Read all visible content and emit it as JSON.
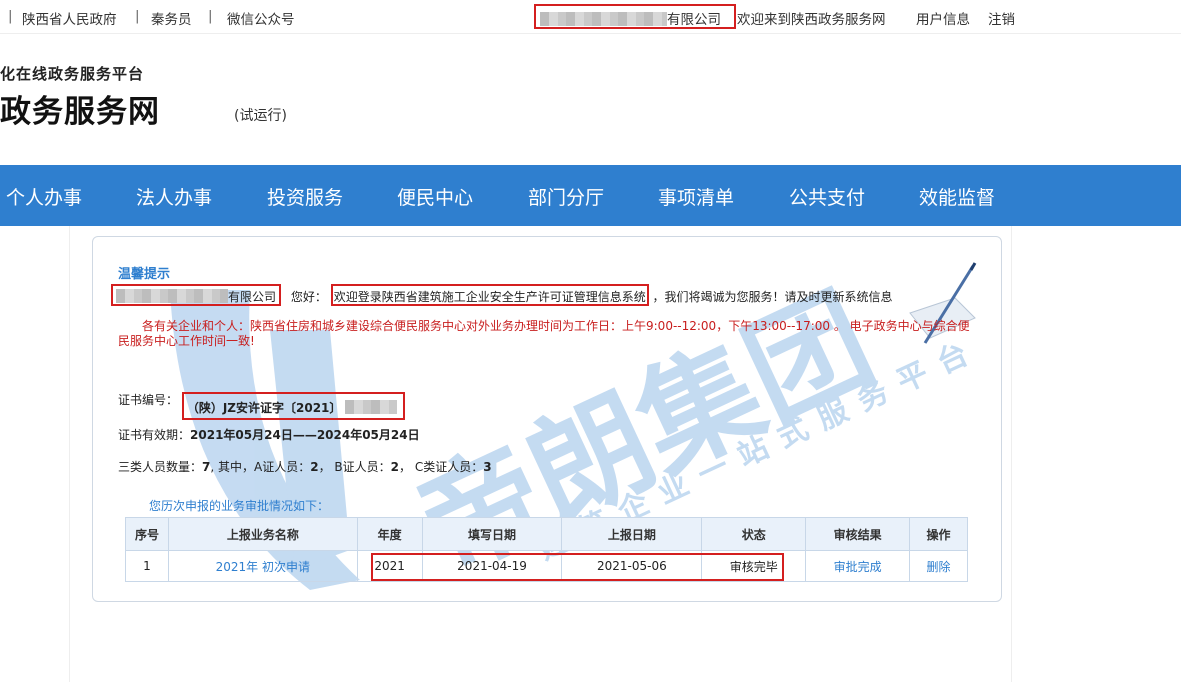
{
  "topbar": {
    "gov_link": "陕西省人民政府",
    "qin_link": "秦务员",
    "wechat_link": "微信公众号",
    "company_suffix": "有限公司",
    "welcome": "欢迎来到陕西政务服务网",
    "user_info": "用户信息",
    "logout": "注销"
  },
  "logo": {
    "subtitle": "化在线政务服务平台",
    "title": "政务服务网",
    "trial": "(试运行)"
  },
  "nav": [
    "个人办事",
    "法人办事",
    "投资服务",
    "便民中心",
    "部门分厅",
    "事项清单",
    "公共支付",
    "效能监督"
  ],
  "content": {
    "tip_title": "温馨提示",
    "company_suffix": "有限公司",
    "greeting": "您好：",
    "welcome_system": "欢迎登录陕西省建筑施工企业安全生产许可证管理信息系统",
    "service_msg": "，我们将竭诚为您服务！请及时更新系统信息",
    "notice": "各有关企业和个人：陕西省住房和城乡建设综合便民服务中心对外业务办理时间为工作日：上午9:00--12:00，下午13:00--17:00 。 电子政务中心与综合便民服务中心工作时间一致!",
    "cert_no_label": "证书编号：",
    "cert_no_value": "（陕）JZ安许证字〔2021〕",
    "validity_label": "证书有效期：",
    "validity_value": "2021年05月24日——2024年05月24日",
    "staff_label": "三类人员数量：",
    "staff_total": "7",
    "staff_mid": ", 其中，A证人员：",
    "staff_a": "2",
    "staff_b_label": "， B证人员：",
    "staff_b": "2",
    "staff_c_label": "， C类证人员：",
    "staff_c": "3",
    "history_title": "您历次申报的业务审批情况如下："
  },
  "table": {
    "headers": [
      "序号",
      "上报业务名称",
      "年度",
      "填写日期",
      "上报日期",
      "状态",
      "审核结果",
      "操作"
    ],
    "rows": [
      {
        "no": "1",
        "name": "2021年 初次申请",
        "year": "2021",
        "fill_date": "2021-04-19",
        "report_date": "2021-05-06",
        "status": "审核完毕",
        "result": "审批完成",
        "action": "删除"
      }
    ]
  },
  "watermark": {
    "brand": "帝朗集团",
    "tagline": "建筑企业一站式服务平台"
  },
  "colors": {
    "nav_bg": "#2f7fcf",
    "accent": "#2f7fcf",
    "notice_red": "#c81e1e",
    "highlight_box": "#d41f1f"
  }
}
